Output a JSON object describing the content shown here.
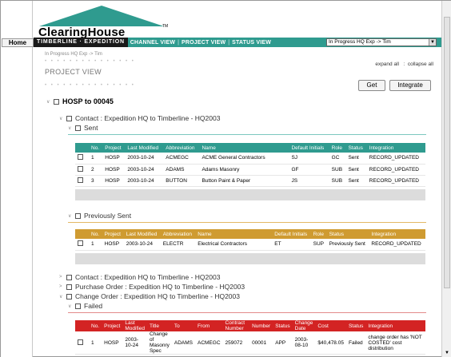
{
  "home": {
    "label": "Home"
  },
  "logo": {
    "text": "ClearingHouse",
    "tm": "TM"
  },
  "nav": {
    "items": [
      "TIMBERLINE · EXPEDITION",
      "CHANNEL VIEW",
      "PROJECT VIEW",
      "STATUS VIEW"
    ],
    "select_value": "In Progress HQ Exp -> Tim"
  },
  "page": {
    "breadcrumb": "In Progress HQ Exp -> Tim",
    "title": "PROJECT VIEW",
    "expand_all": "expand all",
    "collapse_all": "collapse all",
    "get_label": "Get",
    "integrate_label": "Integrate"
  },
  "tree": {
    "root": "HOSP to 00045",
    "contact_expedition": "Contact : Expedition HQ to Timberline - HQ2003",
    "sent": "Sent",
    "previously_sent": "Previously Sent",
    "contact_timberline": "Contact : Expedition HQ to Timberline - HQ2003",
    "purchase_order": "Purchase Order : Expedition HQ to Timberline - HQ2003",
    "change_order": "Change Order : Expedition HQ to Timberline - HQ2003",
    "failed": "Failed"
  },
  "sent_table": {
    "headers": [
      "No.",
      "Project",
      "Last Modified",
      "Abbreviation",
      "Name",
      "Default Initials",
      "Role",
      "Status",
      "Integration"
    ],
    "rows": [
      [
        "1",
        "HOSP",
        "2003-10-24",
        "ACMEGC",
        "ACME General Contractors",
        "SJ",
        "GC",
        "Sent",
        "RECORD_UPDATED"
      ],
      [
        "2",
        "HOSP",
        "2003-10-24",
        "ADAMS",
        "Adams Masonry",
        "GF",
        "SUB",
        "Sent",
        "RECORD_UPDATED"
      ],
      [
        "3",
        "HOSP",
        "2003-10-24",
        "BUTTON",
        "Button Paint & Paper",
        "JS",
        "SUB",
        "Sent",
        "RECORD_UPDATED"
      ]
    ]
  },
  "prev_table": {
    "headers": [
      "No.",
      "Project",
      "Last Modified",
      "Abbreviation",
      "Name",
      "Default Initials",
      "Role",
      "Status",
      "Integration"
    ],
    "rows": [
      [
        "1",
        "HOSP",
        "2003-10-24",
        "ELECTR",
        "Electrical Contractors",
        "ET",
        "SUP",
        "Previously Sent",
        "RECORD_UPDATED"
      ]
    ]
  },
  "failed_table": {
    "headers": [
      "No.",
      "Project",
      "Last Modified",
      "Title",
      "To",
      "From",
      "Contract Number",
      "Number",
      "Status",
      "Change Date",
      "Cost",
      "Status",
      "Integration"
    ],
    "rows": [
      [
        "1",
        "HOSP",
        "2003-10-24",
        "Change of Masonry Spec",
        "ADAMS",
        "ACMEGC",
        "259072",
        "00001",
        "APP",
        "2003-08-10",
        "$40,478.05",
        "Failed",
        "change order has 'NOT COSTED' cost distribution"
      ]
    ]
  },
  "colors": {
    "teal": "#2f9b8f",
    "gold": "#cf9b31",
    "red": "#d32323",
    "nav_active": "#1a1a1a"
  }
}
